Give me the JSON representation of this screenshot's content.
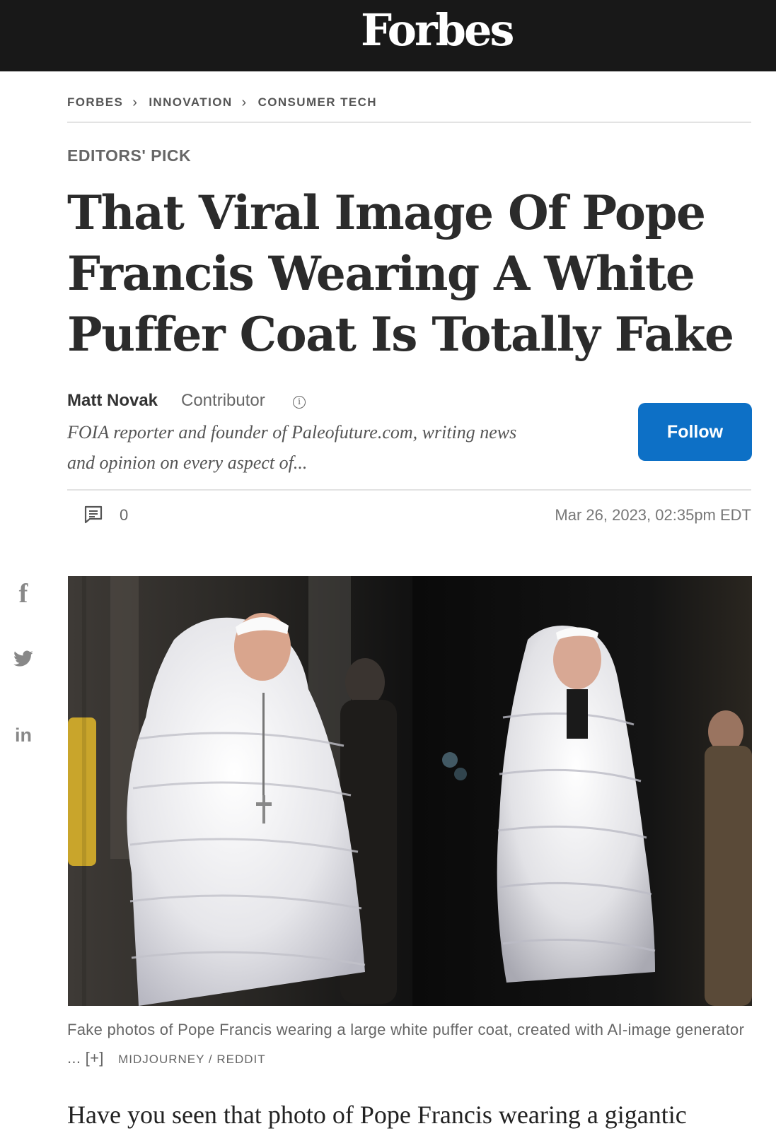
{
  "header": {
    "logo": "Forbes"
  },
  "breadcrumb": {
    "items": [
      "FORBES",
      "INNOVATION",
      "CONSUMER TECH"
    ],
    "separator": "›"
  },
  "article": {
    "section_tag": "EDITORS' PICK",
    "headline": "That Viral Image Of Pope Francis Wearing A White Puffer Coat Is Totally Fake",
    "author": {
      "name": "Matt Novak",
      "role": "Contributor",
      "info_glyph": "i",
      "bio": "FOIA reporter and founder of Paleofuture.com, writing news and opinion on every aspect of..."
    },
    "follow_label": "Follow",
    "comment_count": "0",
    "published": "Mar 26, 2023, 02:35pm EDT",
    "image": {
      "caption": "Fake photos of Pope Francis wearing a large white puffer coat, created with AI-image generator ...",
      "expand_label": "[+]",
      "credit": "MIDJOURNEY / REDDIT"
    },
    "body_first_line": "Have you seen that photo of Pope Francis wearing a gigantic"
  },
  "share": {
    "facebook": "f",
    "linkedin": "in"
  },
  "icons": {
    "comment": "comment-icon",
    "facebook": "facebook-icon",
    "twitter": "twitter-icon",
    "linkedin": "linkedin-icon",
    "info": "info-icon"
  },
  "colors": {
    "topbar": "#181818",
    "follow_button": "#0d70c6",
    "headline": "#2b2b2b",
    "muted_text": "#666666"
  }
}
